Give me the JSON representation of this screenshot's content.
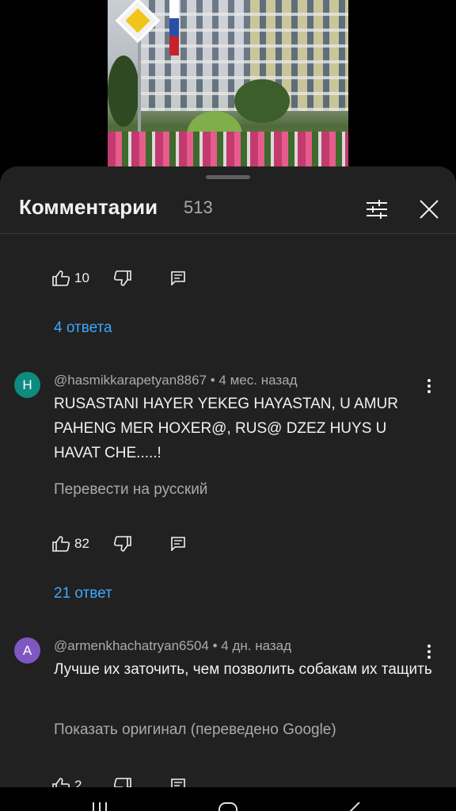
{
  "sheet": {
    "title": "Комментарии",
    "count": "513"
  },
  "thread1": {
    "likes": "10",
    "replies": "4 ответа"
  },
  "comment2": {
    "avatar_letter": "H",
    "avatar_color": "#0f8a7e",
    "author_meta": "@hasmikkarapetyan8867 • 4 мес. назад",
    "text": "RUSASTANI HAYER YEKEG HAYASTAN, U AMUR PAHENG MER HOXER@, RUS@ DZEZ HUYS U HAVAT CHE.....!",
    "translate_label": "Перевести на русский",
    "likes": "82",
    "replies": "21 ответ"
  },
  "comment3": {
    "avatar_letter": "A",
    "avatar_color": "#7e57c2",
    "author_meta": "@armenkhachatryan6504 • 4 дн. назад",
    "text": "Лучше их заточить, чем позволить собакам их тащить",
    "translate_label": "Показать оригинал (переведено Google)",
    "likes": "2"
  },
  "colors": {
    "sheet_bg": "#212121",
    "link": "#3ea6ff",
    "secondary_text": "#aaaaaa"
  },
  "icons": [
    "filter-icon",
    "close-icon",
    "thumb-up-icon",
    "thumb-down-icon",
    "reply-icon",
    "more-vert-icon",
    "recents-icon",
    "home-icon",
    "back-icon"
  ]
}
